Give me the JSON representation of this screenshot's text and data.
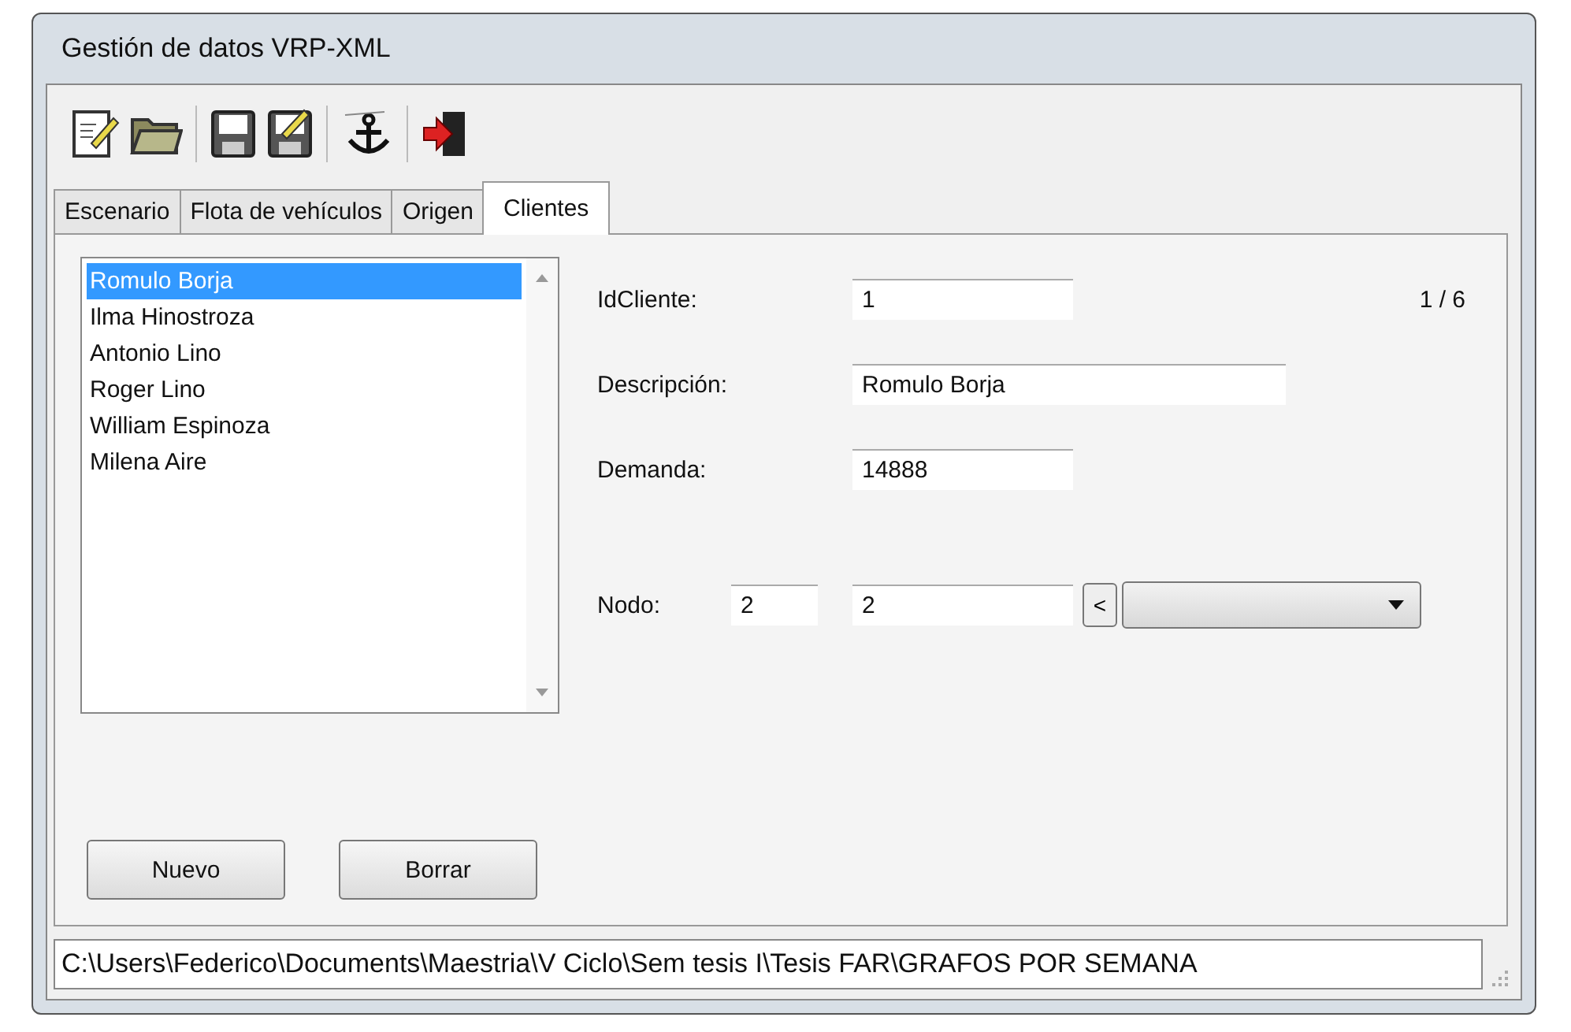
{
  "window": {
    "title": "Gestión de datos VRP-XML"
  },
  "tabs": [
    {
      "label": "Escenario",
      "selected": false
    },
    {
      "label": "Flota de vehículos",
      "selected": false
    },
    {
      "label": "Origen",
      "selected": false
    },
    {
      "label": "Clientes",
      "selected": true
    }
  ],
  "clients": [
    {
      "name": "Romulo Borja",
      "selected": true
    },
    {
      "name": "Ilma Hinostroza",
      "selected": false
    },
    {
      "name": "Antonio Lino",
      "selected": false
    },
    {
      "name": "Roger Lino",
      "selected": false
    },
    {
      "name": "William Espinoza",
      "selected": false
    },
    {
      "name": "Milena Aire",
      "selected": false
    }
  ],
  "form": {
    "id_label": "IdCliente:",
    "id_value": "1",
    "counter": "1 / 6",
    "description_label": "Descripción:",
    "description_value": "Romulo Borja",
    "demand_label": "Demanda:",
    "demand_value": "14888",
    "node_label": "Nodo:",
    "node_value": "2",
    "node_value_2": "2",
    "node_button": "<"
  },
  "buttons": [
    "Nuevo",
    "Borrar"
  ],
  "status_bar": {
    "path": "C:\\Users\\Federico\\Documents\\Maestria\\V Ciclo\\Sem tesis I\\Tesis FAR\\GRAFOS POR SEMANA"
  }
}
